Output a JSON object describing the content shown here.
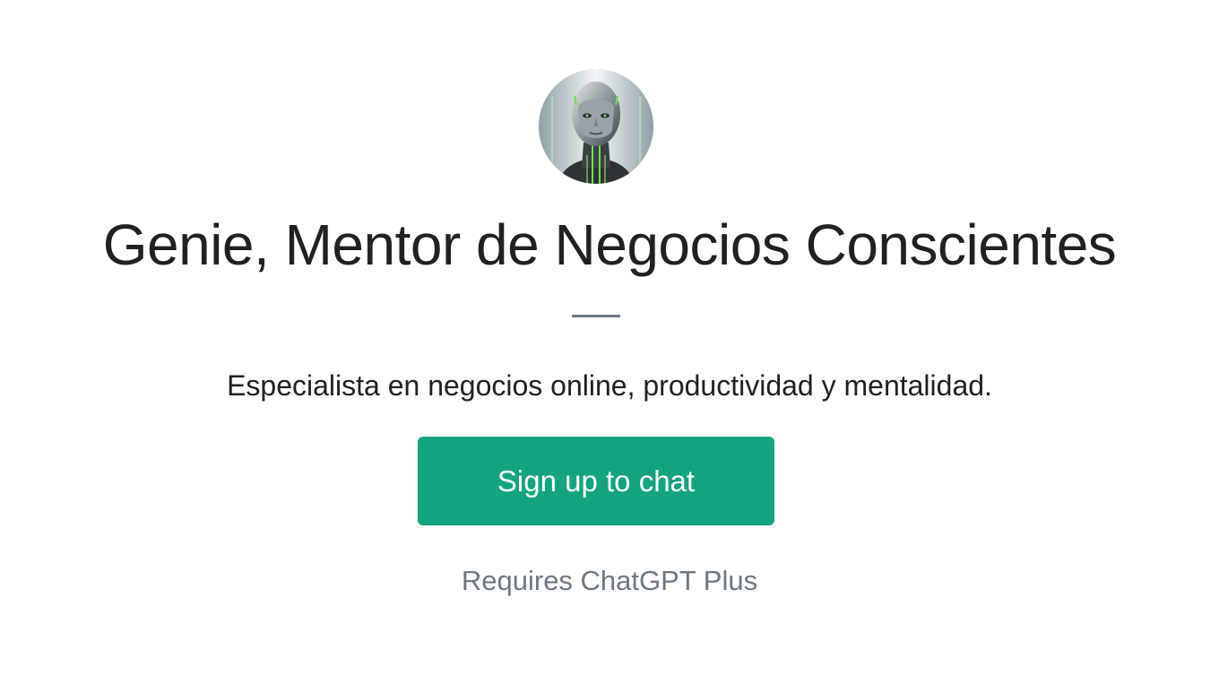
{
  "gpt": {
    "avatar_icon": "robot-portrait-icon",
    "name": "Genie, Mentor de Negocios Conscientes",
    "description": "Especialista en negocios online, productividad y mentalidad."
  },
  "actions": {
    "signup_label": "Sign up to chat"
  },
  "footer": {
    "requirement": "Requires ChatGPT Plus"
  },
  "colors": {
    "accent": "#13a37f",
    "text": "#202123",
    "muted": "#6e7781",
    "background": "#ffffff"
  }
}
